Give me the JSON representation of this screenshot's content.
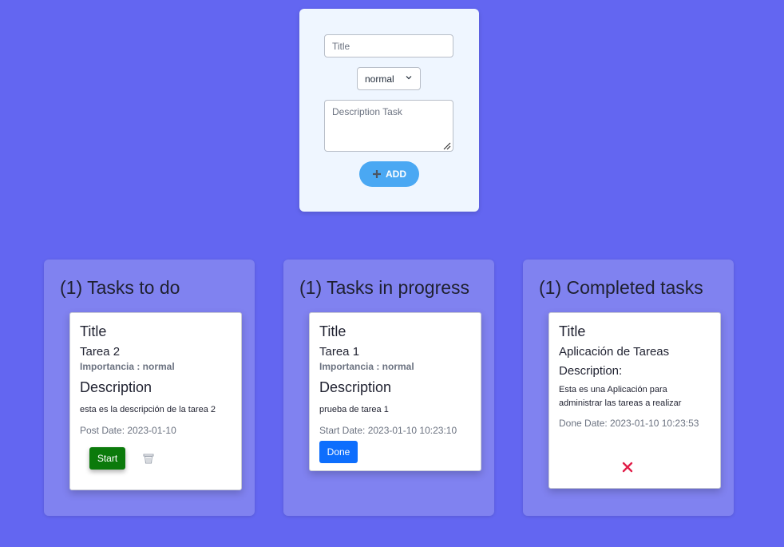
{
  "form": {
    "title_placeholder": "Title",
    "importance_selected": "normal",
    "description_placeholder": "Description Task",
    "add_label": "ADD"
  },
  "columns": [
    {
      "title": "(1) Tasks to do",
      "card": {
        "title_label": "Title",
        "name": "Tarea 2",
        "importance": "Importancia : normal",
        "description_label": "Description",
        "description": "esta es la descripción de la tarea 2",
        "date": "Post Date: 2023-01-10",
        "action_label": "Start",
        "action_icon": "trash-icon"
      }
    },
    {
      "title": "(1) Tasks in progress",
      "card": {
        "title_label": "Title",
        "name": "Tarea 1",
        "importance": "Importancia : normal",
        "description_label": "Description",
        "description": "prueba de tarea 1",
        "date": "Start Date: 2023-01-10 10:23:10",
        "action_label": "Done"
      }
    },
    {
      "title": "(1) Completed tasks",
      "card": {
        "title_label": "Title",
        "name": "Aplicación de Tareas",
        "description_label": "Description:",
        "description": "Esta es una Aplicación para administrar las tareas a realizar",
        "date": "Done Date: 2023-01-10 10:23:53",
        "action_icon": "close-icon"
      }
    }
  ],
  "colors": {
    "background": "#6366f1",
    "column": "#8082f0",
    "form_card": "#eff6ff",
    "add_button": "#4aa8f3",
    "start_button": "#0b7a0b",
    "done_button": "#0d6efd",
    "delete_x": "#e11d48"
  }
}
